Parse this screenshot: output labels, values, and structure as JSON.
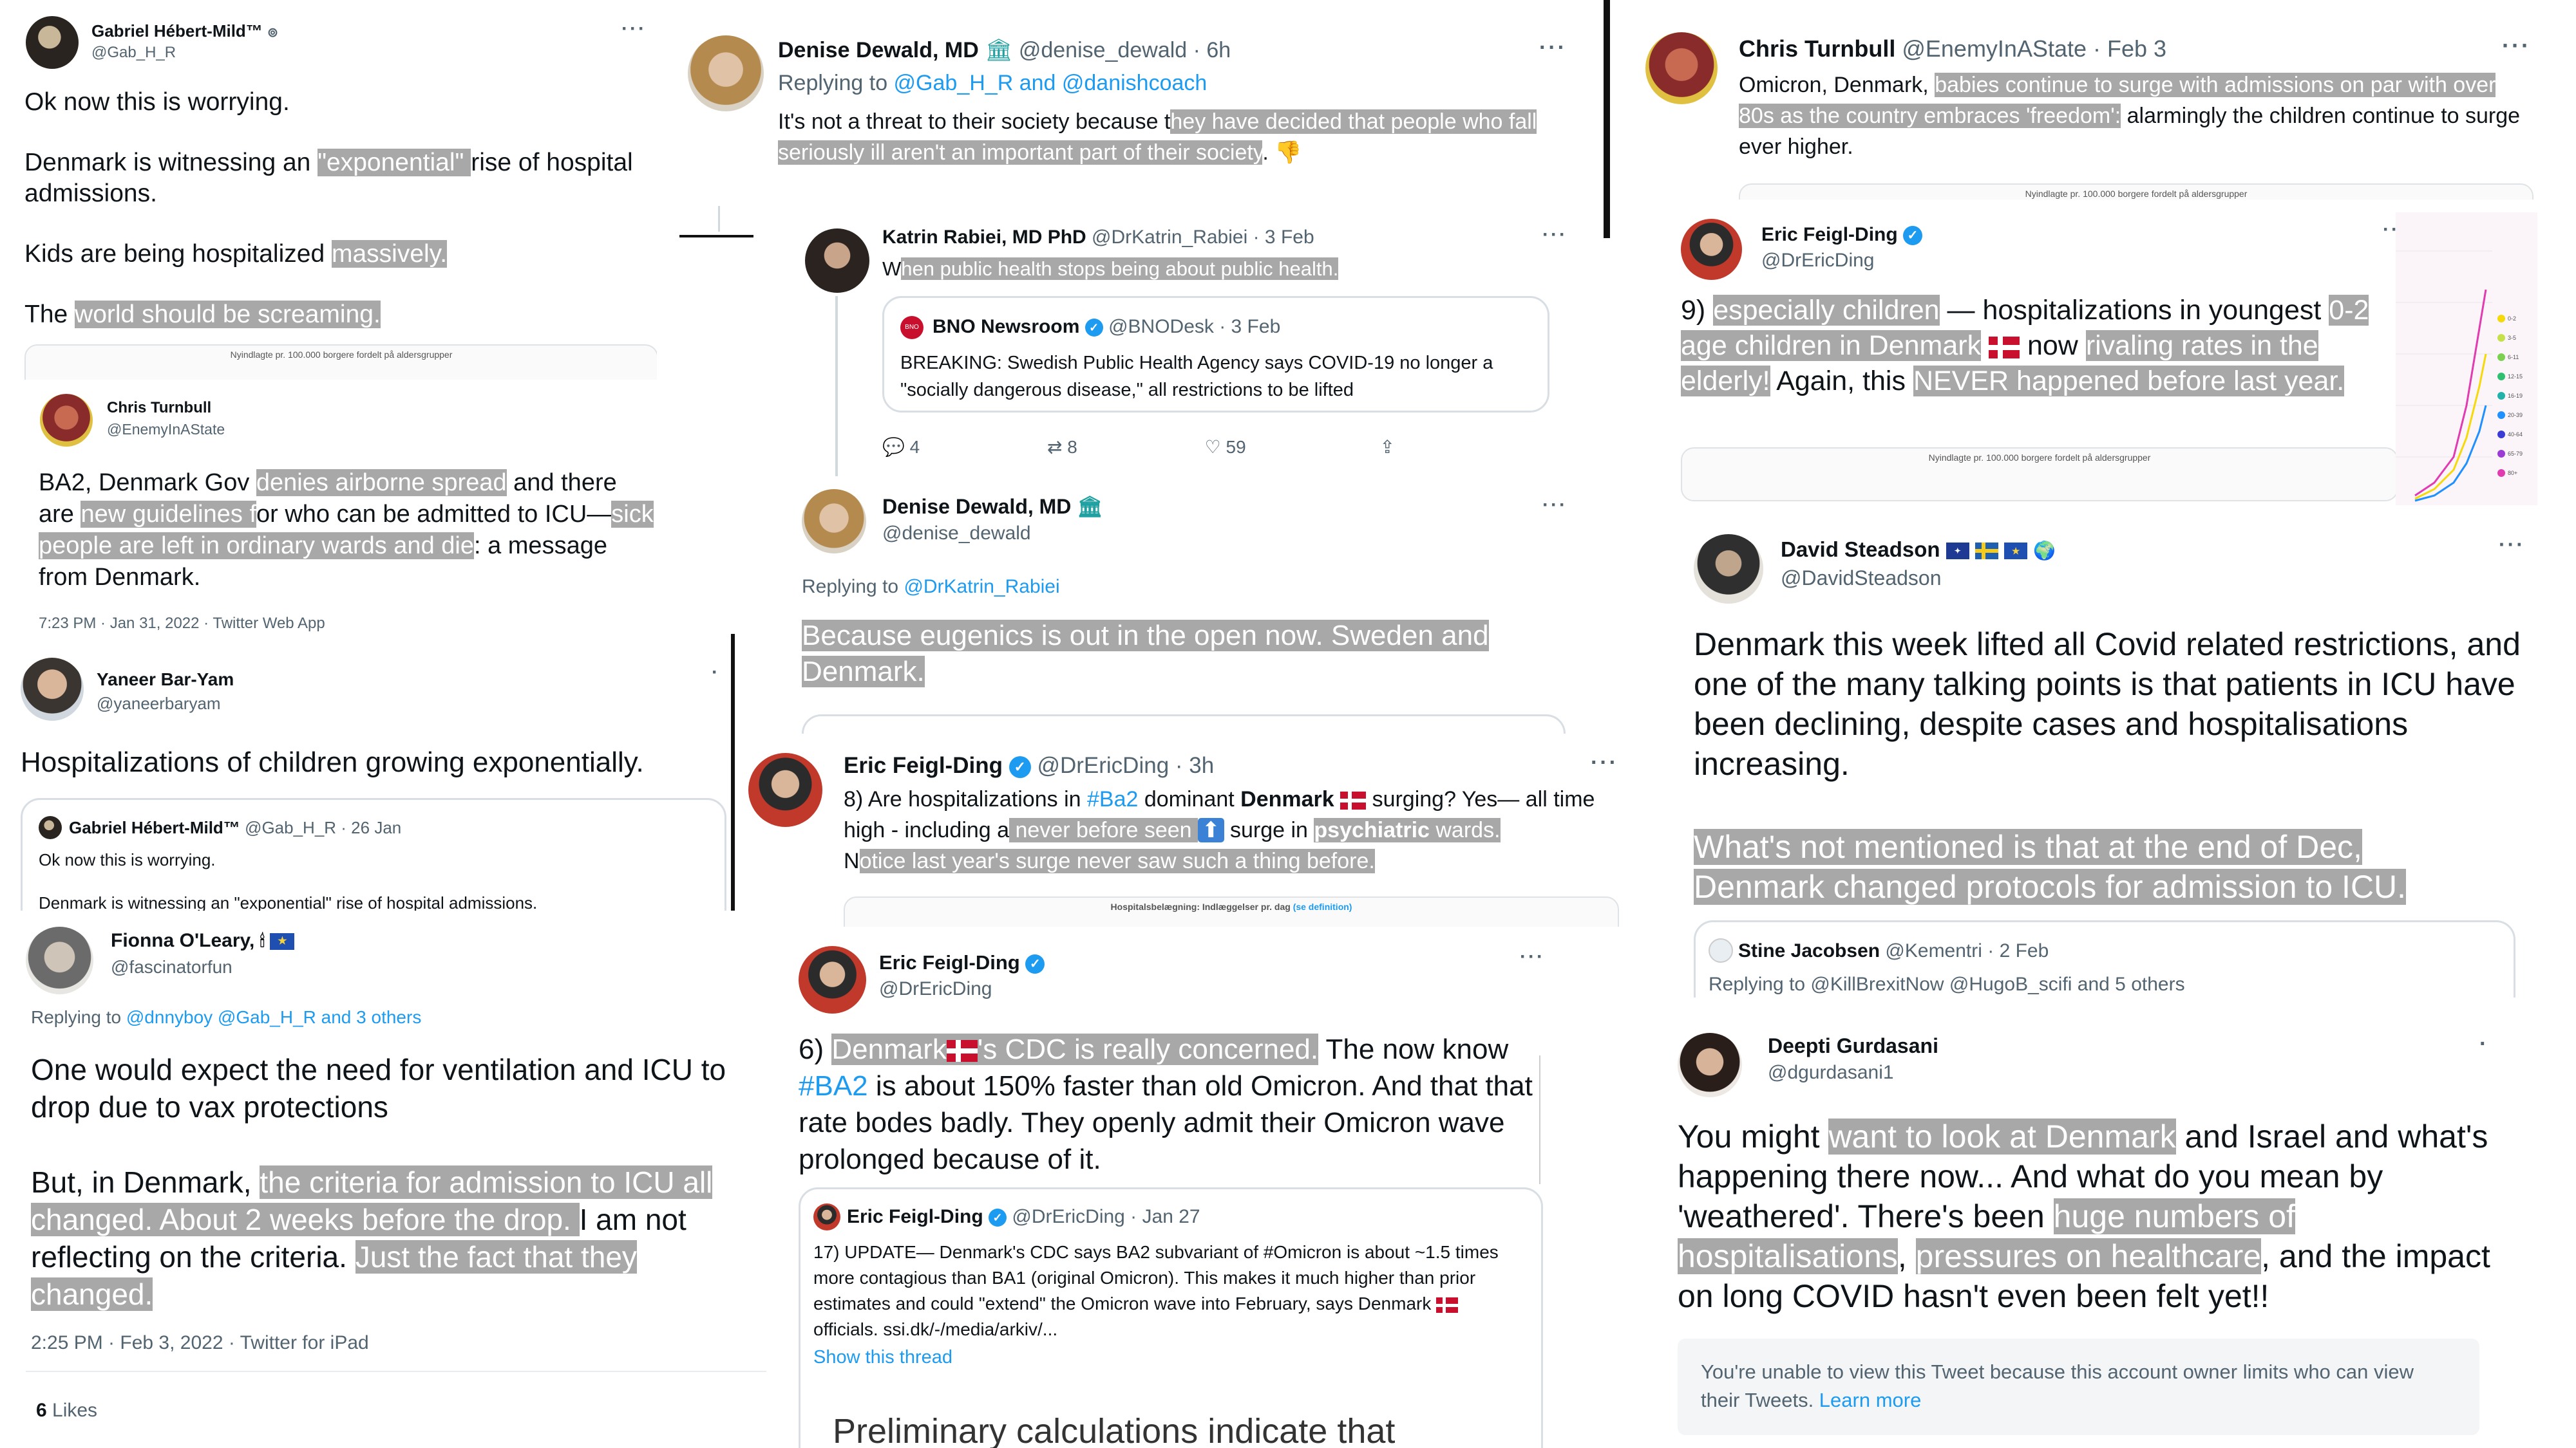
{
  "gabriel_tweet": {
    "name": "Gabriel Hébert-Mild™",
    "handle": "@Gab_H_R",
    "line1": "Ok now this is worrying.",
    "line2_pre": "Denmark is witnessing an ",
    "line2_hl": "\"exponential\" ",
    "line2_post": "rise of hospital admissions.",
    "line3_pre": "Kids are being hospitalized ",
    "line3_hl": "massively.",
    "line4_pre": "The ",
    "line4_hl": "world should be screaming.",
    "chart_caption": "Nyindlagte pr. 100.000 borgere fordelt på aldersgrupper"
  },
  "chris_quote": {
    "name": "Chris Turnbull",
    "handle": "@EnemyInAState",
    "t1": "BA2, Denmark Gov ",
    "t1_hl": "denies airborne spread",
    "t2": " and there are ",
    "t2_hl": "new guidelines f",
    "t3": "or who can be admitted to ICU—",
    "t3_hl": "sick people are left in ordinary wards and die",
    "t4": ": a message from Denmark.",
    "meta": "7:23 PM · Jan 31, 2022 · Twitter Web App"
  },
  "yaneer_tweet": {
    "name": "Yaneer Bar-Yam",
    "handle": "@yaneerbaryam",
    "text": "Hospitalizations of children growing exponentially.",
    "quote_name": "Gabriel Hébert-Mild™",
    "quote_handle": "@Gab_H_R · 26 Jan",
    "quote_line1": "Ok now this is worrying.",
    "quote_line2": "Denmark is witnessing an \"exponential\" rise of hospital admissions."
  },
  "fionna_tweet": {
    "name": "Fionna O'Leary,",
    "handle": "@fascinatorfun",
    "replying_label": "Replying to ",
    "replying_to": "@dnnyboy @Gab_H_R and 3 others",
    "p1": "One would expect the need for ventilation and ICU to drop due to vax protections",
    "p2_pre": "But, in Denmark, ",
    "p2_hl": "the criteria for admission to ICU all changed.  About 2 weeks before the drop. ",
    "p2_mid": " I am not reflecting on the criteria. ",
    "p2_hl2": " Just the fact that they changed.",
    "meta": "2:25 PM · Feb 3, 2022 · Twitter for iPad",
    "likes_count": "6",
    "likes_label": " Likes"
  },
  "denise_tweet": {
    "name": "Denise Dewald, MD",
    "handle": "@denise_dewald · 6h",
    "replying_label": "Replying to ",
    "replying_to": "@Gab_H_R and @danishcoach",
    "text_pre": "It's not a threat to their society because t",
    "text_hl": "hey have decided that people who fall seriously ill aren't an important part of their society",
    "text_post": ". 👎"
  },
  "katrin_tweet": {
    "name": "Katrin Rabiei, MD PhD",
    "handle": "@DrKatrin_Rabiei · 3 Feb",
    "text_pre": "W",
    "text_hl": "hen public health stops being about public health.",
    "quote_name": "BNO Newsroom",
    "quote_handle": "@BNODesk · 3 Feb",
    "quote_text": "BREAKING: Swedish Public Health Agency says COVID-19 no longer a \"socially dangerous disease,\" all restrictions to be lifted",
    "reply_count": "4",
    "retweet_count": "8",
    "like_count": "59"
  },
  "denise_reply": {
    "name": "Denise Dewald, MD",
    "handle": "@denise_dewald",
    "replying_label": "Replying to ",
    "replying_to": "@DrKatrin_Rabiei",
    "text_hl": "Because eugenics is out in the open now. Sweden and Denmark."
  },
  "eric_8": {
    "name": "Eric Feigl-Ding",
    "handle": "@DrEricDing · 3h",
    "t1": "8) Are hospitalizations in ",
    "t1_link": "#Ba2",
    "t1b": " dominant ",
    "t1_bold": "Denmark",
    "t1c": " surging? Yes— all time high - including a",
    "t1_hl": " never before seen ",
    "t1d": " surge in ",
    "t1_hl2": "psychiatric",
    "t1_hl3": " wards.",
    "t2_pre": "N",
    "t2_hl": "otice last year's surge never saw such a thing before.",
    "chart_caption": "Hospitalsbelægning: Indlæggelser pr. dag",
    "chart_caption_link": "(se definition)"
  },
  "eric_6": {
    "name": "Eric Feigl-Ding",
    "handle": "@DrEricDing",
    "p_pre": "6) ",
    "p_hl": "Denmark",
    "p_hl2": "'s CDC is really concerned.",
    "p_mid": " The now know ",
    "p_link": "#BA2",
    "p_post": " is about 150% faster than old Omicron. And that that rate bodes badly. They openly admit their Omicron wave prolonged because of it.",
    "quote_name": "Eric Feigl-Ding",
    "quote_handle": "@DrEricDing · Jan 27",
    "quote_text": "17) UPDATE— Denmark's CDC says BA2 subvariant of #Omicron is about ~1.5 times more contagious than BA1 (original Omicron). This makes it much higher than prior estimates and could \"extend\" the Omicron wave into February, says Denmark",
    "quote_text2": " officials. ssi.dk/-/media/arkiv/...",
    "show_thread": "Show this thread",
    "bottom_text": "Preliminary calculations indicate that"
  },
  "chris_tweet": {
    "name": "Chris Turnbull",
    "handle": "@EnemyInAState · Feb 3",
    "t1": "Omicron, Denmark, ",
    "t1_hl": "babies continue to surge with admissions on par with over 80s as the country embraces 'freedom':",
    "t2": " alarmingly the children continue to surge ever higher.",
    "chart_caption": "Nyindlagte pr. 100.000 borgere fordelt på aldersgrupper"
  },
  "eric_9": {
    "name": "Eric Feigl-Ding",
    "handle": "@DrEricDing",
    "p_pre": "9) ",
    "p_hl1": "especially children",
    "p_mid1": " — hospitalizations in youngest ",
    "p_hl2": "0-2 age children in Denmark",
    "p_mid2": " now ",
    "p_hl3": "rivaling rates in the elderly!",
    "p_mid3": " Again, this ",
    "p_hl4": "NEVER happened before last year.",
    "chart_caption": "Nyindlagte pr. 100.000 borgere fordelt på aldersgrupper"
  },
  "david_tweet": {
    "name": "David Steadson",
    "handle": "@DavidSteadson",
    "p1": "Denmark this week lifted all Covid related restrictions, and one of the many talking points is that patients in ICU have been declining, despite cases and hospitalisations increasing.",
    "p2_hl": "What's not mentioned is that at the end of Dec, Denmark changed protocols for admission to ICU.",
    "quote_name": "Stine Jacobsen",
    "quote_handle": "@Kementri · 2 Feb",
    "quote_replying": "Replying to @KillBrexitNow @HugoB_scifi  and 5 others"
  },
  "deepti_tweet": {
    "name": "Deepti Gurdasani",
    "handle": "@dgurdasani1",
    "t1": "You might ",
    "t1_hl": "want to look at Denmark",
    "t2": " and Israel and what's happening there now...  And what do you mean by 'weathered'. There's been ",
    "t2_hl": "huge numbers of hospitalisations",
    "t3": ", ",
    "t3_hl": "pressures on healthcare",
    "t4": ", and the impact on long COVID hasn't even been felt yet!!",
    "notice": "You're unable to view this Tweet because this account owner limits who can view their Tweets. ",
    "notice_link": "Learn more"
  },
  "legend_labels": [
    "0-2",
    "3-5",
    "6-11",
    "12-15",
    "16-19",
    "20-39",
    "40-64",
    "65-79",
    "80+"
  ],
  "legend_colors": [
    "#f5d90a",
    "#c6e04a",
    "#7bd14f",
    "#2fbf71",
    "#20b2aa",
    "#1e90ff",
    "#3b3bd6",
    "#9b3bd6",
    "#e03bb0"
  ],
  "icons": [
    "more-icon",
    "verified-icon",
    "reply-icon",
    "retweet-icon",
    "like-icon",
    "share-icon",
    "eu-flag-icon",
    "denmark-flag-icon",
    "sweden-flag-icon",
    "australia-flag-icon",
    "globe-icon",
    "hospital-icon"
  ]
}
